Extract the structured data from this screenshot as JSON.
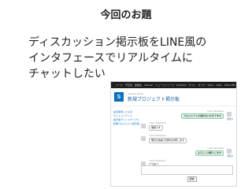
{
  "slide": {
    "title": "今回のお題",
    "body_lines": [
      "ディスカッション掲示板をLINE風の",
      "インタフェースでリアルタイムに",
      "チャットしたい"
    ]
  },
  "screenshot": {
    "topnav": [
      "メール",
      "予定表",
      "連絡先",
      "Yammer",
      "ニュースフィード",
      "OneDrive",
      "サイト",
      "タスク",
      "Delve",
      "Video",
      "Office 365"
    ],
    "breadcrumb": "Contoso Demo",
    "page_title": "新規プロジェクト掲示板",
    "sidebar": {
      "items": [
        "最近使用したもの",
        "サイトコンテンツ",
        "掲示板チャットサンプル",
        "新規プロジェクト掲示板"
      ]
    },
    "posts": [
      {
        "side": "right",
        "meta": "Yuuki Takahashi",
        "text": "プロジェクトの進捗はいかがですか",
        "stamp": "既読2"
      },
      {
        "side": "left",
        "meta": "Yuuki Takahashi",
        "text": "順調です",
        "stamp": ""
      },
      {
        "side": "left",
        "meta": "Yuuki Takahashi",
        "text": "明日の会議で資料を共有します",
        "stamp": ""
      },
      {
        "side": "right",
        "meta": "Yuuki Takahashi",
        "text": "よろしくお願いします",
        "stamp": "既読1"
      },
      {
        "side": "left",
        "meta": "Yuuki Takahashi",
        "text": "了解",
        "stamp": ""
      }
    ],
    "send_label": "送信"
  }
}
